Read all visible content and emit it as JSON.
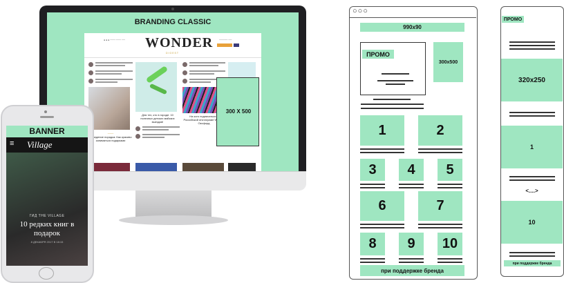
{
  "monitor": {
    "screen_title": "BRANDING CLASSIC",
    "site_logo": "WONDER",
    "site_sublogo": "DIGEST",
    "ad_label": "300 X 500",
    "feature_caption_1": "Для тех, кто в городе: 10 полезных детских майских выездов!",
    "feature_caption_2": "На кого подписаться в Российской инстаграме Wonder Оксфорд",
    "feature_caption_3": "Наведение порядка: Как красиво заниматься подарками"
  },
  "phone": {
    "banner_label": "BANNER",
    "logo": "Village",
    "menu_icon": "menu-icon",
    "kicker": "ГИД THE VILLAGE",
    "headline": "10 редких книг в подарок",
    "date": "8 ДЕКАБРЯ 2017 В 18:15"
  },
  "wireframe_desktop": {
    "top_banner": "990x90",
    "promo_label": "ПРОМО",
    "side_ad": "300x500",
    "tiles": [
      "1",
      "2",
      "3",
      "4",
      "5",
      "6",
      "7",
      "8",
      "9",
      "10"
    ],
    "footer": "при поддержке бренда"
  },
  "wireframe_mobile": {
    "promo_label": "ПРОМО",
    "ad": "320x250",
    "tile_1": "1",
    "ellipsis": "<....>",
    "tile_10": "10",
    "footer": "при поддержке бренда"
  }
}
